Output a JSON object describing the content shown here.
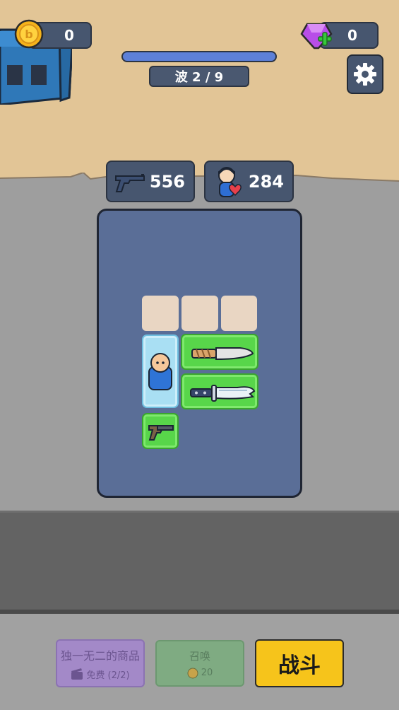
{
  "hud": {
    "gold": "0",
    "gems": "0",
    "wave_label": "波 2 / 9",
    "wave_progress": 1.0
  },
  "stats": {
    "attack": "556",
    "health": "284"
  },
  "inventory": {
    "empty_slots": 3,
    "items": [
      "hero",
      "wooden-knife",
      "hunting-knife",
      "pistol"
    ]
  },
  "buttons": {
    "shop_label": "独一无二的商品",
    "shop_sub": "免费 (2/2)",
    "summon_label": "召唤",
    "summon_cost": "20",
    "battle_label": "战斗"
  },
  "colors": {
    "sand": "#e2c596",
    "panel": "#5a6e97",
    "item_green": "#58d64a",
    "battle_yellow": "#f6c41b",
    "wave_blue": "#5d80d8"
  },
  "icons": [
    "gold-coin-icon",
    "gem-plus-icon",
    "gear-icon",
    "pistol-icon",
    "hero-heart-icon",
    "clapper-icon"
  ]
}
